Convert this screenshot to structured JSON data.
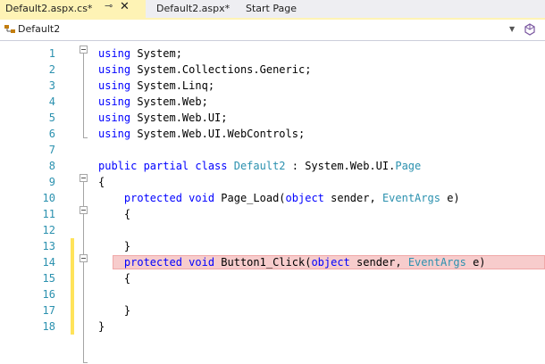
{
  "tabs": [
    {
      "label": "Default2.aspx.cs*",
      "active": true
    },
    {
      "label": "Default2.aspx*",
      "active": false
    },
    {
      "label": "Start Page",
      "active": false
    }
  ],
  "nav": {
    "class_label": "Default2"
  },
  "icons": {
    "pin": "pin-icon",
    "close": "close-icon",
    "class": "class-icon",
    "dropdown": "chevron-down-icon",
    "member": "member-icon"
  },
  "colors": {
    "keyword": "#0000ff",
    "type": "#2b91af",
    "line_number": "#2b91af",
    "breakpoint_highlight": "#f7cccc",
    "change_marker": "#ffe35a",
    "active_tab": "#fef3b5"
  },
  "lines": [
    {
      "num": "1",
      "tokens": [
        [
          "kw",
          "using"
        ],
        [
          "tx",
          " System;"
        ]
      ]
    },
    {
      "num": "2",
      "tokens": [
        [
          "kw",
          "using"
        ],
        [
          "tx",
          " System.Collections.Generic;"
        ]
      ]
    },
    {
      "num": "3",
      "tokens": [
        [
          "kw",
          "using"
        ],
        [
          "tx",
          " System.Linq;"
        ]
      ]
    },
    {
      "num": "4",
      "tokens": [
        [
          "kw",
          "using"
        ],
        [
          "tx",
          " System.Web;"
        ]
      ]
    },
    {
      "num": "5",
      "tokens": [
        [
          "kw",
          "using"
        ],
        [
          "tx",
          " System.Web.UI;"
        ]
      ]
    },
    {
      "num": "6",
      "tokens": [
        [
          "kw",
          "using"
        ],
        [
          "tx",
          " System.Web.UI.WebControls;"
        ]
      ]
    },
    {
      "num": "7",
      "tokens": []
    },
    {
      "num": "8",
      "tokens": [
        [
          "kw",
          "public partial class "
        ],
        [
          "ty",
          "Default2"
        ],
        [
          "tx",
          " : System.Web.UI."
        ],
        [
          "ty",
          "Page"
        ]
      ]
    },
    {
      "num": "9",
      "tokens": [
        [
          "tx",
          "{"
        ]
      ]
    },
    {
      "num": "10",
      "tokens": [
        [
          "tx",
          "    "
        ],
        [
          "kw",
          "protected void"
        ],
        [
          "tx",
          " Page_Load("
        ],
        [
          "kw",
          "object"
        ],
        [
          "tx",
          " sender, "
        ],
        [
          "ty",
          "EventArgs"
        ],
        [
          "tx",
          " e)"
        ]
      ]
    },
    {
      "num": "11",
      "tokens": [
        [
          "tx",
          "    {"
        ]
      ]
    },
    {
      "num": "12",
      "tokens": []
    },
    {
      "num": "13",
      "tokens": [
        [
          "tx",
          "    }"
        ]
      ]
    },
    {
      "num": "14",
      "tokens": [
        [
          "tx",
          "    "
        ],
        [
          "kw",
          "protected void"
        ],
        [
          "tx",
          " Button1_Click("
        ],
        [
          "kw",
          "object"
        ],
        [
          "tx",
          " sender, "
        ],
        [
          "ty",
          "EventArgs"
        ],
        [
          "tx",
          " e)"
        ]
      ],
      "highlighted": true
    },
    {
      "num": "15",
      "tokens": [
        [
          "tx",
          "    {"
        ]
      ]
    },
    {
      "num": "16",
      "tokens": []
    },
    {
      "num": "17",
      "tokens": [
        [
          "tx",
          "    }"
        ]
      ]
    },
    {
      "num": "18",
      "tokens": [
        [
          "tx",
          "}"
        ]
      ]
    }
  ],
  "changed_lines": [
    "13",
    "14",
    "15",
    "16",
    "17",
    "18"
  ]
}
